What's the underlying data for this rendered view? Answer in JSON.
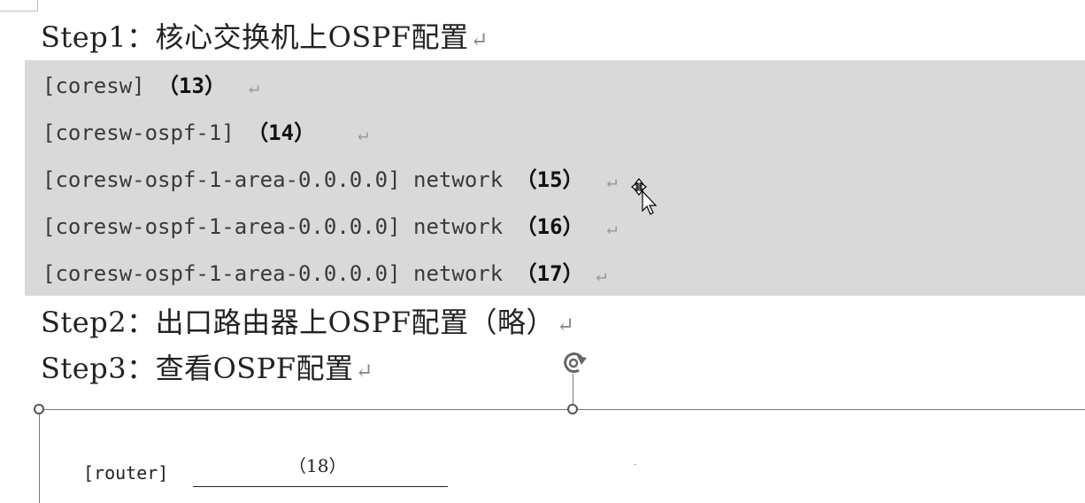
{
  "steps": {
    "step1": "Step1：核心交换机上OSPF配置",
    "step2": "Step2：出口路由器上OSPF配置（略）",
    "step3": "Step3：查看OSPF配置"
  },
  "paragraph_mark": "↵",
  "code_lines": [
    {
      "prefix": "[coresw] ",
      "num": "（13）"
    },
    {
      "prefix": "[coresw-ospf-1] ",
      "num": "（14）"
    },
    {
      "prefix": "[coresw-ospf-1-area-0.0.0.0] network ",
      "num": "（15）"
    },
    {
      "prefix": "[coresw-ospf-1-area-0.0.0.0] network ",
      "num": "（16）"
    },
    {
      "prefix": "[coresw-ospf-1-area-0.0.0.0] network ",
      "num": "（17）"
    }
  ],
  "router": {
    "label": "[router]",
    "num": "（18）"
  },
  "colors": {
    "code_background": "#d9d9d9",
    "text": "#222222"
  }
}
